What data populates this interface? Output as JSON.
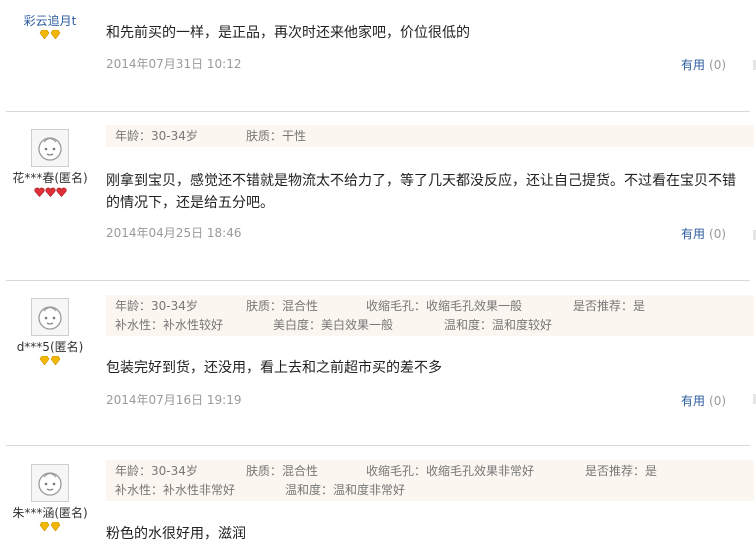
{
  "reviews": [
    {
      "user": "彩云追月t",
      "content": "和先前买的一样，是正品，再次时还来他家吧，价位很低的",
      "date": "2014年07月31日 10:12",
      "useful_label": "有用",
      "useful_count": "(0)"
    },
    {
      "user": "花***春(匿名)",
      "attrs": [
        "年龄：30-34岁",
        "肤质：干性"
      ],
      "content": "刚拿到宝贝，感觉还不错就是物流太不给力了，等了几天都没反应，还让自己提货。不过看在宝贝不错的情况下，还是给五分吧。",
      "date": "2014年04月25日 18:46",
      "useful_label": "有用",
      "useful_count": "(0)"
    },
    {
      "user": "d***5(匿名)",
      "attrs": [
        "年龄：30-34岁",
        "肤质：混合性",
        "收缩毛孔：收缩毛孔效果一般",
        "是否推荐：是",
        "补水性：补水性较好",
        "美白度：美白效果一般",
        "温和度：温和度较好"
      ],
      "content": "包装完好到货，还没用，看上去和之前超市买的差不多",
      "date": "2014年07月16日 19:19",
      "useful_label": "有用",
      "useful_count": "(0)"
    },
    {
      "user": "朱***涵(匿名)",
      "attrs": [
        "年龄：30-34岁",
        "肤质：混合性",
        "收缩毛孔：收缩毛孔效果非常好",
        "是否推荐：是",
        "补水性：补水性非常好",
        "温和度：温和度非常好"
      ],
      "content": "粉色的水很好用，滋润"
    }
  ],
  "colors": {
    "link": "#2b5b9c",
    "attr_bg": "#fbf6ef",
    "gold_medal": "#f2b705",
    "red_medal": "#e0303a"
  },
  "icons": {
    "avatar": "default-avatar-face-icon",
    "gold": "gold-diamond-icon",
    "red": "red-heart-icon"
  }
}
